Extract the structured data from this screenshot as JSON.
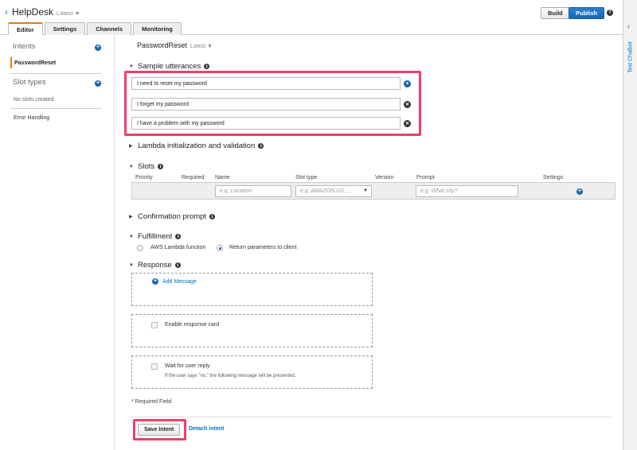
{
  "header": {
    "app_name": "HelpDesk",
    "version": "Latest",
    "build_label": "Build",
    "publish_label": "Publish",
    "help_glyph": "?",
    "tabs": [
      {
        "label": "Editor",
        "active": true
      },
      {
        "label": "Settings",
        "active": false
      },
      {
        "label": "Channels",
        "active": false
      },
      {
        "label": "Monitoring",
        "active": false
      }
    ]
  },
  "right_panel": {
    "label": "Test Chatbot"
  },
  "sidebar": {
    "intents_heading": "Intents",
    "intents": [
      "PasswordReset"
    ],
    "slot_types_heading": "Slot types",
    "no_slots_text": "No slots created",
    "error_handling": "Error Handling"
  },
  "intent": {
    "name": "PasswordReset",
    "version": "Latest"
  },
  "sections": {
    "sample_utterances": "Sample utterances",
    "lambda": "Lambda initialization and validation",
    "slots": "Slots",
    "confirmation": "Confirmation prompt",
    "fulfillment": "Fulfillment",
    "response": "Response"
  },
  "utterances": [
    "I need to reset my password",
    "I forget my password",
    "I have a problem with my password"
  ],
  "slots_table": {
    "columns": [
      "Priority",
      "Required",
      "Name",
      "Slot type",
      "Version",
      "Prompt",
      "Settings"
    ],
    "name_placeholder": "e.g. Location",
    "type_placeholder": "e.g. AMAZON.US_...",
    "prompt_placeholder": "e.g. What city?"
  },
  "fulfillment": {
    "options": [
      "AWS Lambda function",
      "Return parameters to client"
    ],
    "selected": "Return parameters to client"
  },
  "response": {
    "add_message": "Add Message",
    "enable_card": "Enable response card",
    "wait_reply": "Wait for user reply",
    "wait_note": "If the user says \"no,\" the following message will be presented."
  },
  "footer": {
    "required_note": "* Required Field",
    "save_label": "Save Intent",
    "detach_label": "Detach intent"
  },
  "colors": {
    "highlight": "#ef3e6c",
    "accent_orange": "#e47911",
    "link_blue": "#0073bb",
    "primary_blue": "#1a66b3"
  }
}
